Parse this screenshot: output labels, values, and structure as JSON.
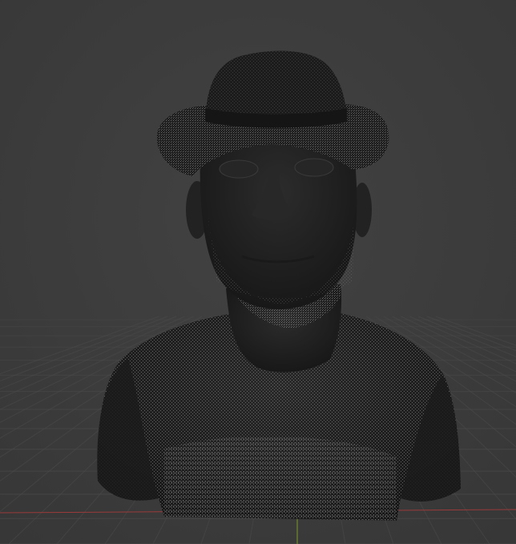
{
  "viewport": {
    "background_color": "#3d3d3d",
    "grid_color": "#4a4a4a",
    "x_axis_color": "#9b3a3a",
    "y_axis_color": "#7a9a2a"
  },
  "model": {
    "subject": "bust",
    "shading": "wireframe-overlay",
    "surface_color": "#202020",
    "wire_color": "#bfbfbf"
  }
}
